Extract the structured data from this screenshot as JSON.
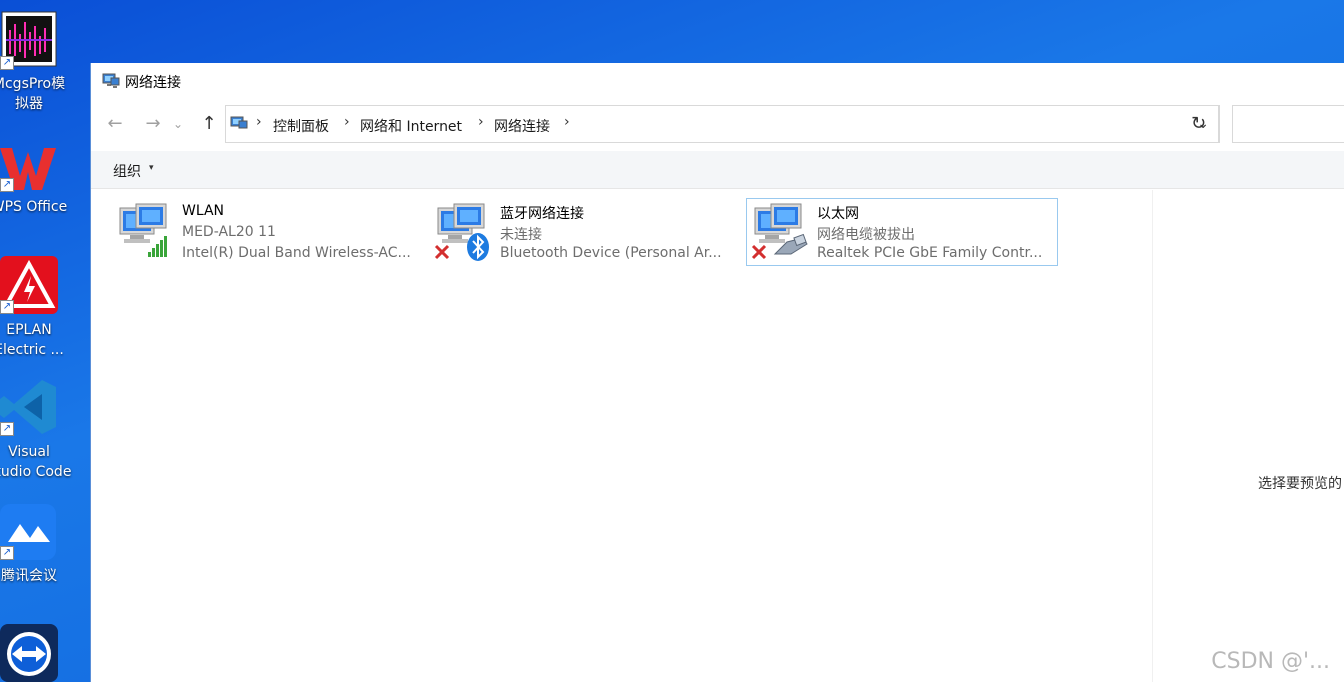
{
  "desktop": {
    "icons": [
      {
        "label_line1": "McgsPro模",
        "label_line2": "拟器",
        "icon": "mcgspro-icon"
      },
      {
        "label_line1": "WPS Office",
        "label_line2": "",
        "icon": "wps-office-icon"
      },
      {
        "label_line1": "EPLAN",
        "label_line2": "Electric ...",
        "icon": "eplan-icon"
      },
      {
        "label_line1": "Visual",
        "label_line2": "Studio Code",
        "icon": "vscode-icon"
      },
      {
        "label_line1": "腾讯会议",
        "label_line2": "",
        "icon": "tencent-meeting-icon"
      },
      {
        "label_line1": "",
        "label_line2": "",
        "icon": "teamviewer-icon"
      }
    ],
    "shortcut_glyph": "↗"
  },
  "window": {
    "title": "网络连接",
    "nav": {
      "back": "←",
      "forward": "→",
      "recent": "⌄",
      "up": "↑"
    },
    "breadcrumb": [
      "控制面板",
      "网络和 Internet",
      "网络连接"
    ],
    "breadcrumb_sep": "›",
    "address_dropdown": "⌄",
    "refresh": "↻",
    "search_placeholder": "",
    "command_bar": {
      "organize": "组织",
      "caret": "▾"
    },
    "connections": [
      {
        "name": "WLAN",
        "status": "MED-AL20 11",
        "device": "Intel(R) Dual Band Wireless-AC...",
        "overlay": "signal-bars-icon",
        "selected": false
      },
      {
        "name": "蓝牙网络连接",
        "status": "未连接",
        "device": "Bluetooth Device (Personal Ar...",
        "overlay": "bluetooth-icon",
        "selected": false
      },
      {
        "name": "以太网",
        "status": "网络电缆被拔出",
        "device": "Realtek PCIe GbE Family Contr...",
        "overlay": "ethernet-cable-icon",
        "selected": true
      }
    ],
    "preview_text": "选择要预览的"
  },
  "watermark": "CSDN @'...",
  "colors": {
    "desktop": "#1a78e8",
    "selection_border": "#99c9ef",
    "error_red": "#d32f2f",
    "bluetooth_blue": "#1e7be0",
    "signal_green": "#3aa53a"
  }
}
